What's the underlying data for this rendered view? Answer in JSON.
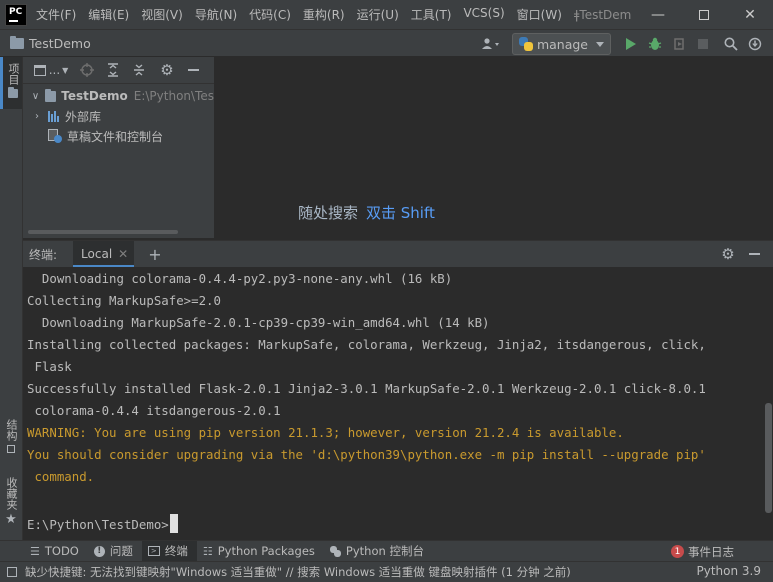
{
  "titlebar": {
    "menu": [
      "文件(F)",
      "编辑(E)",
      "视图(V)",
      "导航(N)",
      "代码(C)",
      "重构(R)",
      "运行(U)",
      "工具(T)",
      "VCS(S)",
      "窗口(W)"
    ],
    "window_title": "TestDem"
  },
  "navbar": {
    "project": "TestDemo",
    "run_config": "manage"
  },
  "left_stripe": {
    "project_tab": "项目",
    "structure_tab": "结构",
    "favorites_tab": "收藏夹"
  },
  "project_panel": {
    "toolbar_dropdown": "...",
    "tree": {
      "root": {
        "label": "TestDemo",
        "path": "E:\\Python\\Tes"
      },
      "external_libs": "外部库",
      "scratches": "草稿文件和控制台"
    }
  },
  "editor": {
    "hint_label": "随处搜索",
    "hint_shortcut": "双击 Shift"
  },
  "terminal": {
    "title": "终端:",
    "tab_label": "Local",
    "lines": [
      "  Downloading colorama-0.4.4-py2.py3-none-any.whl (16 kB)",
      "Collecting MarkupSafe>=2.0",
      "  Downloading MarkupSafe-2.0.1-cp39-cp39-win_amd64.whl (14 kB)",
      "Installing collected packages: MarkupSafe, colorama, Werkzeug, Jinja2, itsdangerous, click,",
      " Flask",
      "Successfully installed Flask-2.0.1 Jinja2-3.0.1 MarkupSafe-2.0.1 Werkzeug-2.0.1 click-8.0.1",
      " colorama-0.4.4 itsdangerous-2.0.1",
      "WARNING: You are using pip version 21.1.3; however, version 21.2.4 is available.",
      "You should consider upgrading via the 'd:\\python39\\python.exe -m pip install --upgrade pip'",
      " command.",
      "E:\\Python\\TestDemo>"
    ]
  },
  "tool_windows": {
    "todo": "TODO",
    "problems": "问题",
    "terminal": "终端",
    "python_packages": "Python Packages",
    "python_console": "Python 控制台",
    "event_log": "事件日志",
    "event_log_count": "1"
  },
  "status_bar": {
    "message": "缺少快捷键: 无法找到键映射\"Windows 适当重做\" // 搜索 Windows 适当重做 键盘映射插件 (1 分钟 之前)",
    "interpreter": "Python 3.9"
  },
  "colors": {
    "accent": "#4a88c7",
    "warning_text": "#c99a2e",
    "run_green": "#59a869",
    "error_badge": "#c74b4b"
  }
}
